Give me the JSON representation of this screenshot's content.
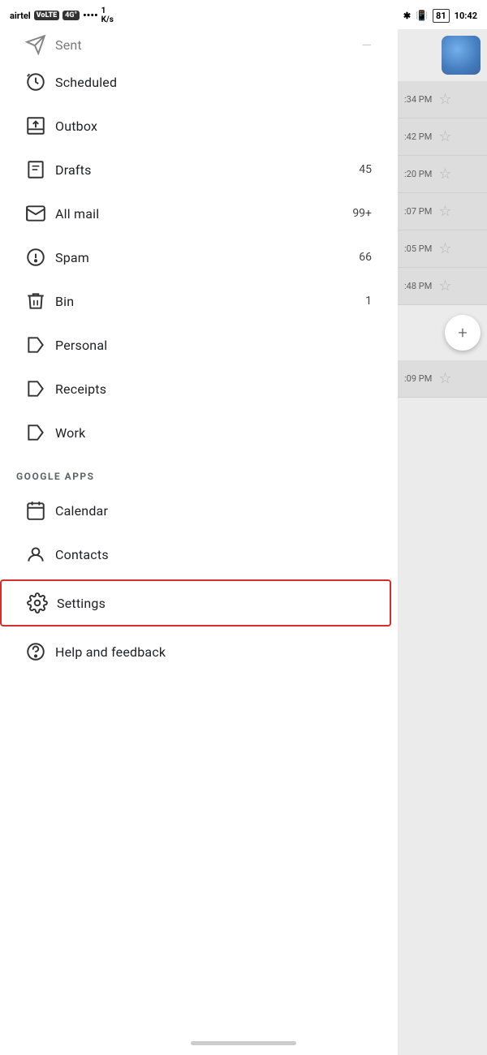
{
  "statusBar": {
    "carrier": "airtel",
    "badges": [
      "VoLTE",
      "4G°"
    ],
    "signal": "signal",
    "dataSpeed": "1\nK/s",
    "bluetooth": "✱",
    "battery": "81",
    "time": "10:42"
  },
  "drawer": {
    "sentLabel": "Sent",
    "menuItems": [
      {
        "id": "scheduled",
        "label": "Scheduled",
        "icon": "scheduled",
        "badge": ""
      },
      {
        "id": "outbox",
        "label": "Outbox",
        "icon": "outbox",
        "badge": ""
      },
      {
        "id": "drafts",
        "label": "Drafts",
        "icon": "drafts",
        "badge": "45"
      },
      {
        "id": "all-mail",
        "label": "All mail",
        "icon": "all-mail",
        "badge": "99+"
      },
      {
        "id": "spam",
        "label": "Spam",
        "icon": "spam",
        "badge": "66"
      },
      {
        "id": "bin",
        "label": "Bin",
        "icon": "bin",
        "badge": "1"
      },
      {
        "id": "personal",
        "label": "Personal",
        "icon": "label",
        "badge": ""
      },
      {
        "id": "receipts",
        "label": "Receipts",
        "icon": "label",
        "badge": ""
      },
      {
        "id": "work",
        "label": "Work",
        "icon": "label",
        "badge": ""
      }
    ],
    "googleAppsSection": "GOOGLE APPS",
    "googleApps": [
      {
        "id": "calendar",
        "label": "Calendar",
        "icon": "calendar"
      },
      {
        "id": "contacts",
        "label": "Contacts",
        "icon": "contacts"
      }
    ],
    "settingsLabel": "Settings",
    "helpLabel": "Help and feedback"
  },
  "rightPanel": {
    "times": [
      ":34 PM",
      ":42 PM",
      ":20 PM",
      ":07 PM",
      ":05 PM",
      ":48 PM",
      ":09 PM"
    ]
  }
}
